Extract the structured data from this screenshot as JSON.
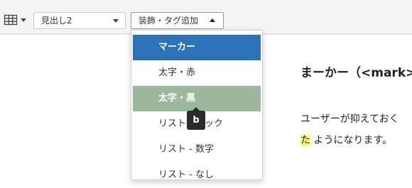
{
  "toolbar": {
    "table_icon": "table-icon",
    "heading_select": {
      "value": "見出し2"
    },
    "decoration_select": {
      "value": "装飾・タグ追加"
    }
  },
  "dropdown": {
    "items": [
      {
        "label": "マーカー",
        "state": "selected"
      },
      {
        "label": "太字・赤",
        "state": "normal"
      },
      {
        "label": "太字・黒",
        "state": "hover"
      },
      {
        "label": "リストチェック",
        "state": "normal"
      },
      {
        "label": "リスト - 数字",
        "state": "normal"
      },
      {
        "label": "リスト - なし",
        "state": "normal"
      }
    ],
    "tooltip": "b"
  },
  "content": {
    "heading": "まーかー（<mark>",
    "line1": "ユーザーが抑えておく",
    "line2_marked": "た",
    "line2_rest": "ようになります。"
  },
  "colors": {
    "selected": "#2b73b6",
    "hover": "#9cb89c",
    "marker": "#fcfc6a",
    "tooltip": "#2b2b2b"
  }
}
